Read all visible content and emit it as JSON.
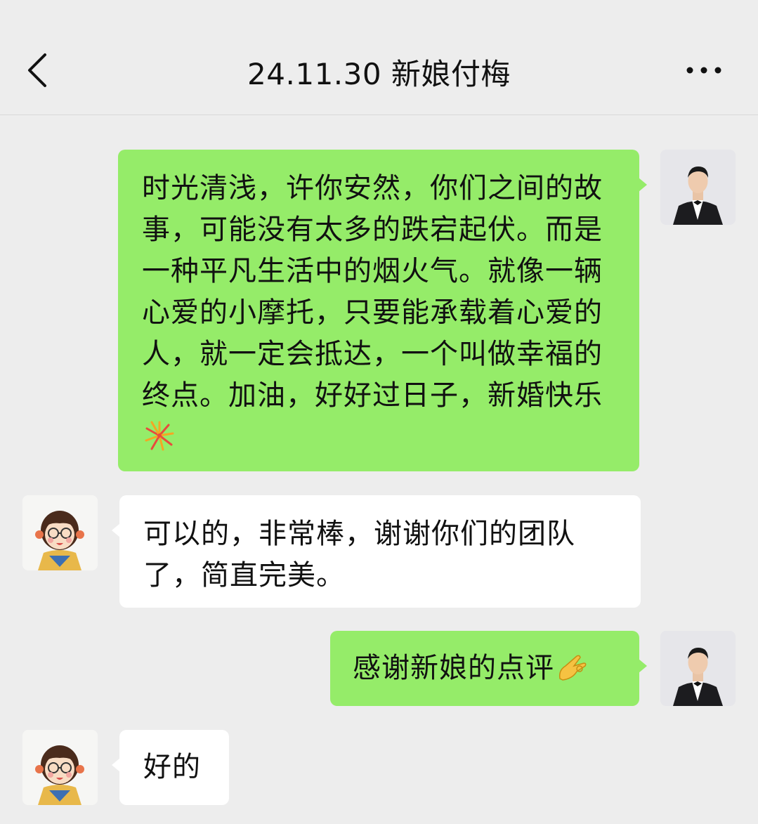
{
  "header": {
    "title": "24.11.30 新娘付梅",
    "back_icon": "chevron-left-icon",
    "more_icon": "ellipsis-icon"
  },
  "colors": {
    "background": "#ededed",
    "outgoing_bubble": "#95ec69",
    "incoming_bubble": "#ffffff"
  },
  "messages": [
    {
      "side": "outgoing",
      "sender": "groom-avatar",
      "text": "时光清浅，许你安然，你们之间的故事，可能没有太多的跌宕起伏。而是一种平凡生活中的烟火气。就像一辆心爱的小摩托，只要能承载着心爱的人，就一定会抵达，一个叫做幸福的终点。加油，好好过日子，新婚快乐",
      "emoji": "fireworks-emoji"
    },
    {
      "side": "incoming",
      "sender": "bride-avatar",
      "text": "可以的，非常棒，谢谢你们的团队了，简直完美。"
    },
    {
      "side": "outgoing",
      "sender": "groom-avatar",
      "text": "感谢新娘的点评",
      "emoji": "ok-hand-emoji"
    },
    {
      "side": "incoming",
      "sender": "bride-avatar",
      "text": "好的"
    }
  ]
}
